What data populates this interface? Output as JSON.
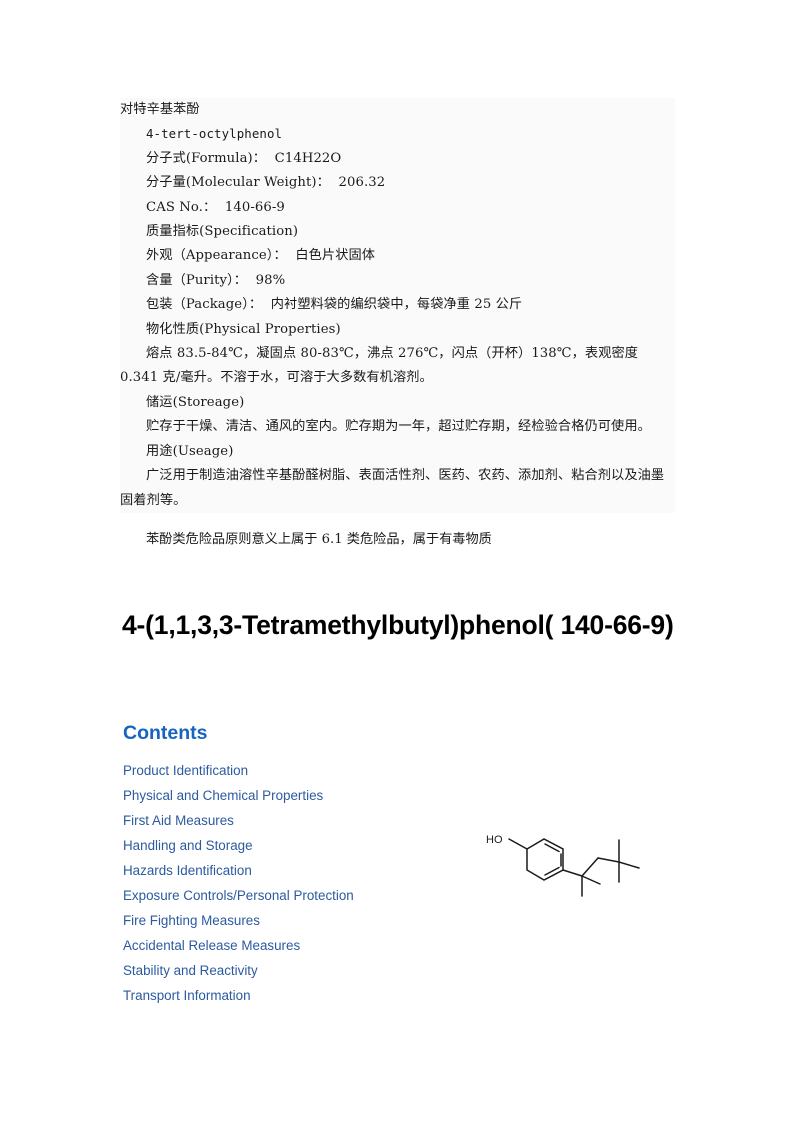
{
  "datasheet": {
    "heading": "对特辛基苯酚",
    "lines": [
      {
        "text": "4-tert-octylphenol",
        "mono": true
      },
      {
        "text": "分子式(Formula)：  C14H22O",
        "mono": false
      },
      {
        "text": "分子量(Molecular Weight)：  206.32",
        "mono": false
      },
      {
        "text": "CAS No.：  140-66-9",
        "mono": false
      },
      {
        "text": "质量指标(Specification)",
        "mono": false
      },
      {
        "text": "外观（Appearance）：  白色片状固体",
        "mono": false
      },
      {
        "text": "含量（Purity）：  98%",
        "mono": false
      },
      {
        "text": "包装（Package）：  内衬塑料袋的编织袋中，每袋净重 25 公斤",
        "mono": false
      },
      {
        "text": "物化性质(Physical Properties)",
        "mono": false
      },
      {
        "text": "熔点 83.5-84℃，凝固点 80-83℃，沸点 276℃，闪点（开杯）138℃，表观密度 0.341 克/毫升。不溶于水，可溶于大多数有机溶剂。",
        "mono": false
      },
      {
        "text": "储运(Storeage)",
        "mono": false
      },
      {
        "text": "贮存于干燥、清洁、通风的室内。贮存期为一年，超过贮存期，经检验合格仍可使用。",
        "mono": false
      },
      {
        "text": "用途(Useage)",
        "mono": false
      },
      {
        "text": "广泛用于制造油溶性辛基酚醛树脂、表面活性剂、医药、农药、添加剂、粘合剂以及油墨固着剂等。",
        "mono": false
      }
    ],
    "trailing_line": "苯酚类危险品原则意义上属于 6.1 类危险品，属于有毒物质"
  },
  "title": "4-(1,1,3,3-Tetramethylbutyl)phenol( 140-66-9)",
  "contents": {
    "heading": "Contents",
    "items": [
      "Product Identification",
      "Physical and Chemical Properties",
      "First Aid Measures",
      "Handling and Storage",
      "Hazards Identification",
      "Exposure Controls/Personal Protection",
      "Fire Fighting Measures",
      "Accidental Release Measures",
      "Stability and Reactivity",
      "Transport Information"
    ]
  },
  "structure": {
    "hydroxyl_label": "HO",
    "caption": "4-tert-octylphenol skeletal structure"
  },
  "colors": {
    "contents_heading": "#1565c0",
    "link": "#2c5aa0",
    "shaded_block": "#fafafa",
    "body_text": "#1a1a1a"
  }
}
